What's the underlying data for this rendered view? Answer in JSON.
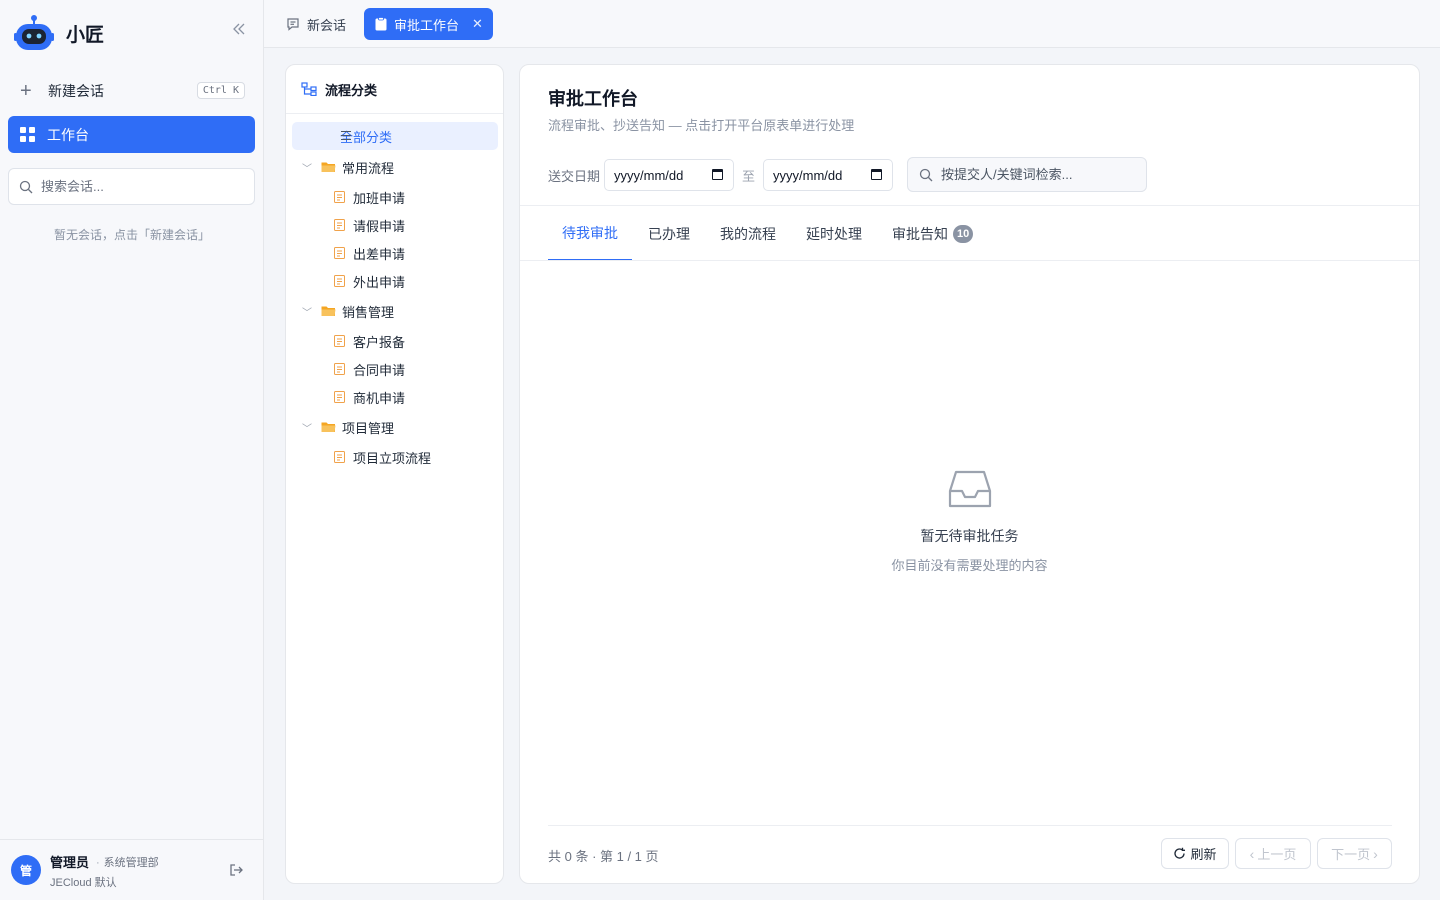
{
  "app": {
    "name": "小匠"
  },
  "sidebar": {
    "new_chat_label": "新建会话",
    "shortcut": "Ctrl K",
    "workbench_label": "工作台",
    "search_placeholder": "搜索会话...",
    "empty_text": "暂无会话，点击「新建会话」"
  },
  "user": {
    "avatar_char": "管",
    "name": "管理员",
    "department": "系统管理部",
    "tenant": "JECloud 默认"
  },
  "tabs": [
    {
      "label": "新会话",
      "active": false
    },
    {
      "label": "审批工作台",
      "active": true
    }
  ],
  "categories": {
    "title": "流程分类",
    "all_label": "全部分类",
    "groups": [
      {
        "label": "常用流程",
        "items": [
          "加班申请",
          "请假申请",
          "出差申请",
          "外出申请"
        ]
      },
      {
        "label": "销售管理",
        "items": [
          "客户报备",
          "合同申请",
          "商机申请"
        ]
      },
      {
        "label": "项目管理",
        "items": [
          "项目立项流程"
        ]
      }
    ]
  },
  "main": {
    "title": "审批工作台",
    "subtitle": "流程审批、抄送告知 — 点击打开平台原表单进行处理",
    "date_label": "送交日期",
    "date_placeholder": "yyyy/mm/dd",
    "date_separator": "至",
    "search_placeholder": "按提交人/关键词检索...",
    "tabs": [
      {
        "label": "待我审批",
        "active": true
      },
      {
        "label": "已办理"
      },
      {
        "label": "我的流程"
      },
      {
        "label": "延时处理"
      },
      {
        "label": "审批告知",
        "badge": "10"
      }
    ],
    "empty_title": "暂无待审批任务",
    "empty_sub": "你目前没有需要处理的内容",
    "page_info": "共 0 条 · 第 1 / 1 页",
    "refresh_label": "刷新",
    "prev_label": "上一页",
    "next_label": "下一页"
  },
  "colors": {
    "accent": "#2f6df6",
    "folder": "#f5a623",
    "doc": "#f0a24a"
  }
}
